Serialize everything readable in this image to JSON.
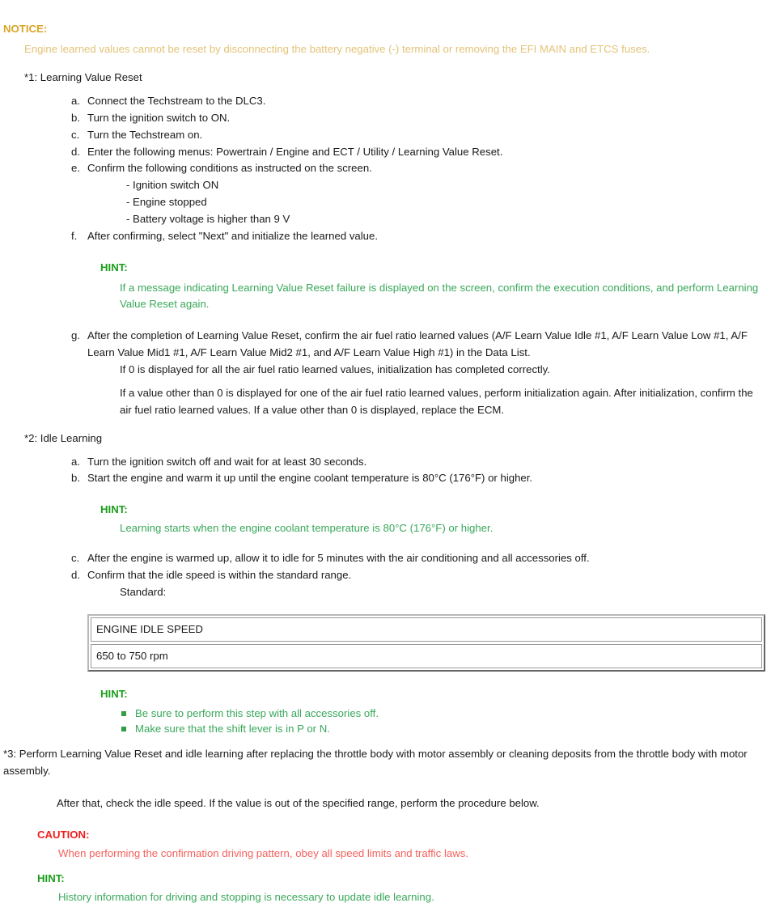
{
  "notice": {
    "label": "NOTICE:",
    "body": "Engine learned values cannot be reset by disconnecting the battery negative (-) terminal or removing the EFI MAIN and ETCS fuses."
  },
  "section1": {
    "heading": "*1: Learning Value Reset",
    "steps": [
      {
        "marker": "a.",
        "text": "Connect the Techstream to the DLC3."
      },
      {
        "marker": "b.",
        "text": "Turn the ignition switch to ON."
      },
      {
        "marker": "c.",
        "text": "Turn the Techstream on."
      },
      {
        "marker": "d.",
        "text": "Enter the following menus: Powertrain / Engine and ECT / Utility / Learning Value Reset."
      },
      {
        "marker": "e.",
        "text": "Confirm the following conditions as instructed on the screen."
      }
    ],
    "conditions": [
      "- Ignition switch ON",
      "- Engine stopped",
      "- Battery voltage is higher than 9 V"
    ],
    "step_f": {
      "marker": "f.",
      "text": "After confirming, select \"Next\" and initialize the learned value."
    },
    "hint": {
      "label": "HINT:",
      "body": "If a message indicating Learning Value Reset failure is displayed on the screen, confirm the execution conditions, and perform Learning Value Reset again."
    },
    "step_g": {
      "marker": "g.",
      "text": "After the completion of Learning Value Reset, confirm the air fuel ratio learned values (A/F Learn Value Idle #1, A/F Learn Value Low #1, A/F Learn Value Mid1 #1, A/F Learn Value Mid2 #1, and A/F Learn Value High #1) in the Data List."
    },
    "step_g_notes": [
      "If 0 is displayed for all the air fuel ratio learned values, initialization has completed correctly.",
      "If a value other than 0 is displayed for one of the air fuel ratio learned values, perform initialization again. After initialization, confirm the air fuel ratio learned values. If a value other than 0 is displayed, replace the ECM."
    ]
  },
  "section2": {
    "heading": "*2: Idle Learning",
    "steps_ab": [
      {
        "marker": "a.",
        "text": "Turn the ignition switch off and wait for at least 30 seconds."
      },
      {
        "marker": "b.",
        "text": "Start the engine and warm it up until the engine coolant temperature is 80°C (176°F) or higher."
      }
    ],
    "hint": {
      "label": "HINT:",
      "body": "Learning starts when the engine coolant temperature is 80°C (176°F) or higher."
    },
    "steps_cd": [
      {
        "marker": "c.",
        "text": "After the engine is warmed up, allow it to idle for 5 minutes with the air conditioning and all accessories off."
      },
      {
        "marker": "d.",
        "text": "Confirm that the idle speed is within the standard range."
      }
    ],
    "standard_label": "Standard:",
    "spec_table": {
      "header": "ENGINE IDLE SPEED",
      "value": "650 to 750 rpm"
    },
    "hint2": {
      "label": "HINT:",
      "items": [
        "Be sure to perform this step with all accessories off.",
        "Make sure that the shift lever is in P or N."
      ]
    }
  },
  "section3": {
    "body": "*3: Perform Learning Value Reset and idle learning after replacing the throttle body with motor assembly or cleaning deposits from the throttle body with motor assembly.",
    "after_that": "After that, check the idle speed. If the value is out of the specified range, perform the procedure below.",
    "caution": {
      "label": "CAUTION:",
      "body": "When performing the confirmation driving pattern, obey all speed limits and traffic laws."
    },
    "hint": {
      "label": "HINT:",
      "body": "History information for driving and stopping is necessary to update idle learning."
    }
  }
}
